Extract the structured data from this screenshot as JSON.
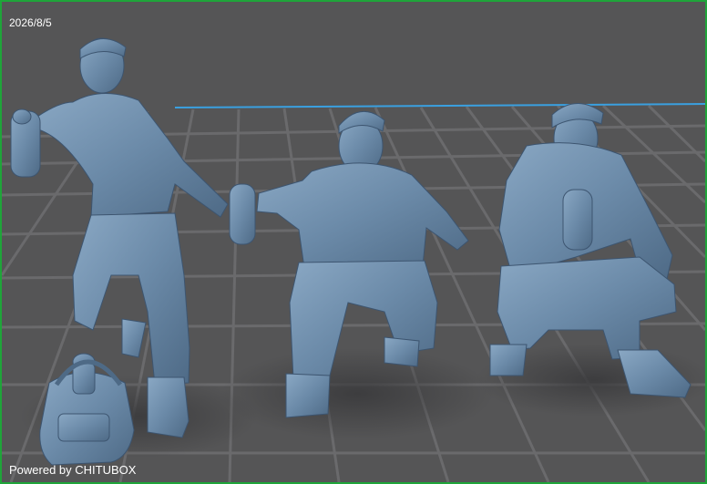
{
  "viewport": {
    "date": "2026/8/5",
    "watermark": "Powered by CHITUBOX",
    "accent_border_color": "#1fa53a",
    "background_color": "#555556",
    "grid_color": "#6a6a6c",
    "grid_highlight_color": "#3aa0e0",
    "model_color": "#6f8fae"
  },
  "models": [
    {
      "name": "standing-figure-with-spray-can"
    },
    {
      "name": "crouching-figure-center"
    },
    {
      "name": "crouching-figure-right"
    },
    {
      "name": "duffel-bag-with-cans"
    }
  ]
}
